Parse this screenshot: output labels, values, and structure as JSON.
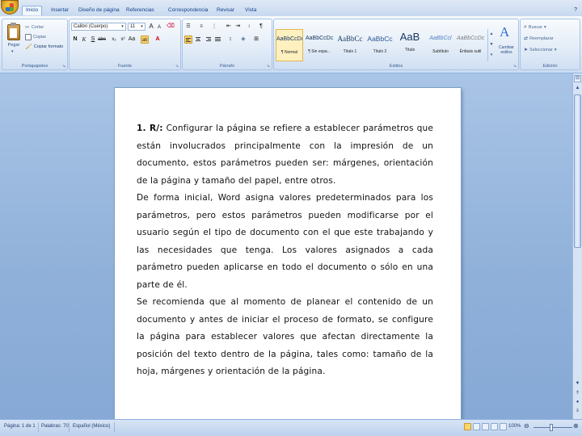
{
  "tabs": [
    {
      "label": "Inicio",
      "active": true
    },
    {
      "label": "Insertar"
    },
    {
      "label": "Diseño de página"
    },
    {
      "label": "Referencias"
    },
    {
      "label": "Correspondencia"
    },
    {
      "label": "Revisar"
    },
    {
      "label": "Vista"
    }
  ],
  "clipboard": {
    "paste_label": "Pegar",
    "cut_label": "Cortar",
    "copy_label": "Copiar",
    "format_painter_label": "Copiar formato",
    "group_label": "Portapapeles"
  },
  "font": {
    "name": "Calibri (Cuerpo)",
    "size": "11",
    "group_label": "Fuente"
  },
  "paragraph": {
    "group_label": "Párrafo"
  },
  "styles": {
    "items": [
      {
        "sample": "AaBbCcDc",
        "name": "¶ Normal",
        "active": true
      },
      {
        "sample": "AaBbCcDc",
        "name": "¶ Sin espa..."
      },
      {
        "sample": "AaBbCc",
        "name": "Título 1"
      },
      {
        "sample": "AaBbCc",
        "name": "Título 2"
      },
      {
        "sample": "AaB",
        "name": "Título"
      },
      {
        "sample": "AaBbCcl",
        "name": "Subtítulo"
      },
      {
        "sample": "AaBbCcDc",
        "name": "Énfasis sutil"
      }
    ],
    "change_styles_label": "Cambiar estilos",
    "group_label": "Estilos"
  },
  "editing": {
    "find_label": "Buscar",
    "replace_label": "Reemplazar",
    "select_label": "Seleccionar",
    "group_label": "Edición"
  },
  "document": {
    "paragraphs": [
      {
        "prefix": "1. R/:",
        "text": " Configurar la página se refiere a establecer parámetros que están involucrados principalmente con la impresión de un documento, estos parámetros pueden ser: márgenes, orientación de la página y tamaño del papel, entre otros."
      },
      {
        "text": "De forma inicial, Word asigna valores predeterminados para los parámetros, pero estos parámetros pueden modificarse por el usuario según el tipo de documento con el que este trabajando y las necesidades que tenga. Los valores asignados a cada parámetro pueden aplicarse en todo el documento o sólo en una parte de él."
      },
      {
        "text": "Se recomienda que al momento de planear el contenido de un documento y antes de iniciar el proceso de formato, se configure la página para establecer valores que afectan directamente la posición del texto dentro de la página, tales como: tamaño de la hoja, márgenes y orientación de la página."
      }
    ]
  },
  "status": {
    "pages": "Página: 1 de 1",
    "words": "Palabras: 70",
    "language": "Español (México)",
    "zoom": "100%"
  },
  "colors": {
    "ribbon_border": "#8db2e3",
    "workspace": "#8fb0d9",
    "label_text": "#15428b"
  }
}
